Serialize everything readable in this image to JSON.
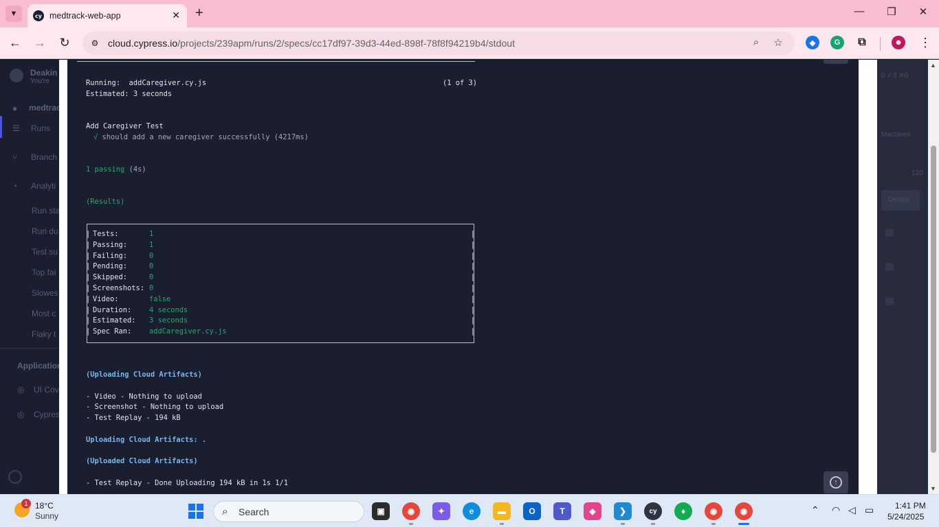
{
  "browser": {
    "tab_title": "medtrack-web-app",
    "tab_favicon": "cy",
    "url_host": "cloud.cypress.io",
    "url_path": "/projects/239apm/runs/2/specs/cc17df97-39d3-44ed-898f-78f8f94219b4/stdout",
    "icons": {
      "tab_list": "chevron-down-icon",
      "close_tab": "close-icon",
      "new_tab": "plus-icon",
      "back": "back-arrow-icon",
      "forward": "forward-arrow-icon",
      "reload": "reload-icon",
      "site_info": "tune-icon",
      "zoom": "zoom-icon",
      "bookmark": "star-icon",
      "extensions": "puzzle-icon",
      "menu": "kebab-menu-icon"
    },
    "window_controls": {
      "minimize": "—",
      "maximize": "❐",
      "close": "✕"
    }
  },
  "background_app": {
    "sidebar": [
      "Deakin",
      "You're",
      "medtrack",
      "Runs",
      "Branch",
      "Analyti",
      "Run sta",
      "Run du",
      "Test su",
      "Top fai",
      "Slowes",
      "Most c",
      "Flaky t",
      "Application",
      "UI Cov",
      "Cypres"
    ],
    "right_panel": {
      "counts": "0  ✓3  ✕0",
      "machines": "Machines",
      "number": "120",
      "button": "Details"
    }
  },
  "stdout": {
    "running_label": "Running:  addCaregiver.cy.js",
    "running_count": "(1 of 3)",
    "estimated": "Estimated: 3 seconds",
    "suite_title": "Add Caregiver Test",
    "check_mark": "√",
    "test_line": "should add a new caregiver successfully",
    "test_duration": "(4217ms)",
    "passing": "1 passing",
    "passing_duration": "(4s)",
    "results_heading": "(Results)",
    "results": [
      {
        "label": "Tests:",
        "value": "1"
      },
      {
        "label": "Passing:",
        "value": "1"
      },
      {
        "label": "Failing:",
        "value": "0"
      },
      {
        "label": "Pending:",
        "value": "0"
      },
      {
        "label": "Skipped:",
        "value": "0"
      },
      {
        "label": "Screenshots:",
        "value": "0"
      },
      {
        "label": "Video:",
        "value": "false"
      },
      {
        "label": "Duration:",
        "value": "4 seconds"
      },
      {
        "label": "Estimated:",
        "value": "3 seconds"
      },
      {
        "label": "Spec Ran:",
        "value": "addCaregiver.cy.js"
      }
    ],
    "uploading_heading": "(Uploading Cloud Artifacts)",
    "upload_items": [
      "- Video - Nothing to upload",
      "- Screenshot - Nothing to upload",
      "- Test Replay - 194 kB"
    ],
    "uploading_progress": "Uploading Cloud Artifacts: .",
    "uploaded_heading": "(Uploaded Cloud Artifacts)",
    "uploaded_item": "- Test Replay - Done Uploading 194 kB in 1s 1/1"
  },
  "taskbar": {
    "weather_temp": "18°C",
    "weather_condition": "Sunny",
    "weather_badge": "1",
    "search_placeholder": "Search",
    "apps": [
      "file-explorer-icon",
      "chrome-profile-icon",
      "copilot-icon",
      "edge-icon",
      "folder-icon",
      "outlook-icon",
      "teams-icon",
      "photos-icon",
      "vscode-icon",
      "cypress-icon",
      "mongodb-icon",
      "chrome-icon",
      "chrome-active-icon"
    ],
    "time": "1:41 PM",
    "date": "5/24/2025"
  },
  "colors": {
    "terminal_bg": "#1b1e2e",
    "terminal_green": "#1fa971",
    "terminal_blue": "#75b7f0",
    "chrome_frame": "#f8bdd0"
  }
}
